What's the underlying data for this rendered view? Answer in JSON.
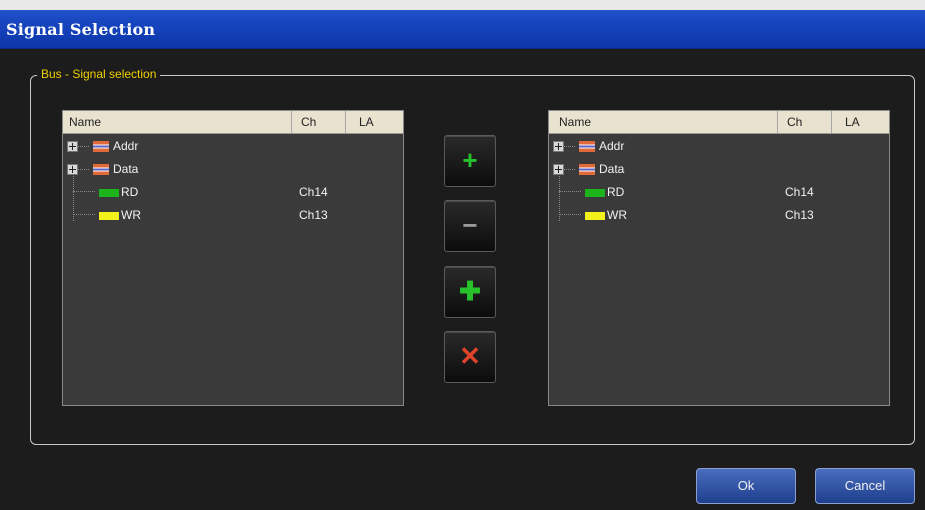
{
  "window": {
    "title": "Signal Selection"
  },
  "group": {
    "legend": "Bus - Signal selection"
  },
  "left_panel": {
    "columns": [
      "Name",
      "Ch",
      "LA"
    ],
    "rows": [
      {
        "name": "Addr",
        "ch": "",
        "kind": "bus"
      },
      {
        "name": "Data",
        "ch": "",
        "kind": "bus"
      },
      {
        "name": "RD",
        "ch": "Ch14",
        "kind": "signal",
        "color": "#1bb51b"
      },
      {
        "name": "WR",
        "ch": "Ch13",
        "kind": "signal",
        "color": "#f2f21a"
      }
    ]
  },
  "right_panel": {
    "columns": [
      "Name",
      "Ch",
      "LA"
    ],
    "rows": [
      {
        "name": "Addr",
        "ch": "",
        "kind": "bus"
      },
      {
        "name": "Data",
        "ch": "",
        "kind": "bus"
      },
      {
        "name": "RD",
        "ch": "Ch14",
        "kind": "signal",
        "color": "#1bb51b"
      },
      {
        "name": "WR",
        "ch": "Ch13",
        "kind": "signal",
        "color": "#f2f21a"
      }
    ]
  },
  "actions": {
    "add": {
      "glyph": "+",
      "color": "#27c12b",
      "icon": "plus-icon"
    },
    "remove": {
      "glyph": "−",
      "color": "#9a9a9a",
      "icon": "minus-icon"
    },
    "add_all": {
      "glyph": "✚",
      "color": "#27c12b",
      "icon": "add-all-icon"
    },
    "clear": {
      "glyph": "✕",
      "color": "#e0452a",
      "icon": "delete-icon"
    }
  },
  "footer": {
    "ok_label": "Ok",
    "cancel_label": "Cancel"
  }
}
